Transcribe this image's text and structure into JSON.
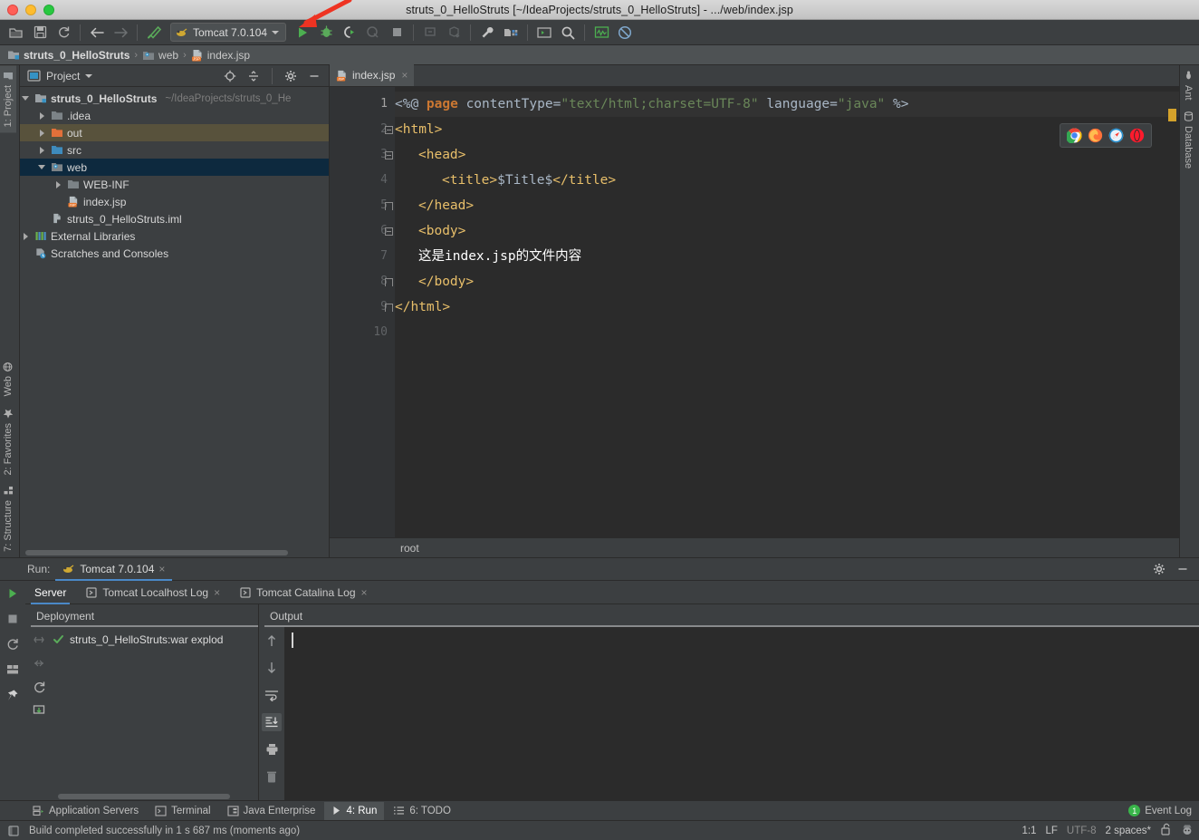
{
  "window": {
    "title": "struts_0_HelloStruts [~/IdeaProjects/struts_0_HelloStruts] - .../web/index.jsp"
  },
  "toolbar": {
    "run_config_label": "Tomcat 7.0.104",
    "icons": [
      "open-folder-icon",
      "save-all-icon",
      "sync-refresh-icon",
      "back-arrow-icon",
      "forward-arrow-icon",
      "build-hammer-icon",
      "run-icon",
      "debug-icon",
      "run-with-coverage-icon",
      "profile-icon",
      "stop-icon",
      "update-app-icon",
      "deploy-icon",
      "settings-wrench-icon",
      "project-structure-icon",
      "terminal-icon",
      "search-everywhere-icon",
      "monitor-icon",
      "no-access-icon"
    ]
  },
  "breadcrumb": {
    "items": [
      {
        "label": "struts_0_HelloStruts",
        "icon": "module-icon"
      },
      {
        "label": "web",
        "icon": "web-folder-icon"
      },
      {
        "label": "index.jsp",
        "icon": "jsp-file-icon"
      }
    ],
    "separator": "›"
  },
  "left_toolbar": {
    "top": [
      {
        "label": "1: Project",
        "active": true
      }
    ],
    "bottom": [
      {
        "label": "Web",
        "icon": "web-icon"
      },
      {
        "label": "2: Favorites",
        "icon": "star-icon",
        "underline": "2"
      },
      {
        "label": "7: Structure",
        "icon": "structure-icon",
        "underline": "7"
      }
    ]
  },
  "right_toolbar": {
    "items": [
      {
        "label": "Ant",
        "icon": "ant-icon"
      },
      {
        "label": "Database",
        "icon": "database-icon"
      }
    ]
  },
  "project_panel": {
    "title": "Project",
    "header_icons": [
      "locate-target-icon",
      "collapse-all-icon",
      "gear-icon",
      "hide-minimize-icon"
    ],
    "tree": [
      {
        "label": "struts_0_HelloStruts",
        "sub": "~/IdeaProjects/struts_0_He",
        "indent": 0,
        "arrow": "down",
        "icon": "module-icon",
        "bold": true,
        "state": "normal"
      },
      {
        "label": ".idea",
        "sub": "",
        "indent": 1,
        "arrow": "right",
        "icon": "folder-icon",
        "bold": false,
        "state": "normal"
      },
      {
        "label": "out",
        "sub": "",
        "indent": 1,
        "arrow": "right",
        "icon": "folder-orange-icon",
        "bold": false,
        "state": "highlight"
      },
      {
        "label": "src",
        "sub": "",
        "indent": 1,
        "arrow": "right",
        "icon": "folder-source-icon",
        "bold": false,
        "state": "normal"
      },
      {
        "label": "web",
        "sub": "",
        "indent": 1,
        "arrow": "down",
        "icon": "web-folder-icon",
        "bold": false,
        "state": "selected"
      },
      {
        "label": "WEB-INF",
        "sub": "",
        "indent": 2,
        "arrow": "right",
        "icon": "folder-icon",
        "bold": false,
        "state": "normal"
      },
      {
        "label": "index.jsp",
        "sub": "",
        "indent": 2,
        "arrow": "none",
        "icon": "jsp-file-icon",
        "bold": false,
        "state": "normal"
      },
      {
        "label": "struts_0_HelloStruts.iml",
        "sub": "",
        "indent": 1,
        "arrow": "none",
        "icon": "iml-file-icon",
        "bold": false,
        "state": "normal"
      },
      {
        "label": "External Libraries",
        "sub": "",
        "indent": 0,
        "arrow": "right",
        "icon": "libraries-icon",
        "bold": false,
        "state": "normal"
      },
      {
        "label": "Scratches and Consoles",
        "sub": "",
        "indent": 0,
        "arrow": "none",
        "icon": "scratches-icon",
        "bold": false,
        "state": "normal"
      }
    ]
  },
  "editor": {
    "tab": {
      "label": "index.jsp",
      "icon": "jsp-file-icon",
      "close": "×"
    },
    "breadcrumb_label": "root",
    "browsers": [
      {
        "name": "chrome-icon",
        "color": "#4285f4"
      },
      {
        "name": "firefox-icon",
        "color": "#ff7139"
      },
      {
        "name": "safari-icon",
        "color": "#1b88ca"
      },
      {
        "name": "opera-icon",
        "color": "#ff1b2d"
      }
    ],
    "line_numbers": [
      "1",
      "2",
      "3",
      "4",
      "5",
      "6",
      "7",
      "8",
      "9",
      "10"
    ],
    "code_lines": [
      {
        "n": 1,
        "indent": 0,
        "tokens": [
          {
            "t": "<%@ ",
            "c": "k-gray"
          },
          {
            "t": "page",
            "c": "k-orangeb"
          },
          {
            "t": " contentType=",
            "c": "k-gray"
          },
          {
            "t": "\"text/html;charset=UTF-8\"",
            "c": "k-green"
          },
          {
            "t": " language=",
            "c": "k-gray"
          },
          {
            "t": "\"java\"",
            "c": "k-green"
          },
          {
            "t": " %>",
            "c": "k-gray"
          }
        ],
        "highlight": true
      },
      {
        "n": 2,
        "indent": 0,
        "tokens": [
          {
            "t": "<html>",
            "c": "k-tag"
          }
        ],
        "highlight": false
      },
      {
        "n": 3,
        "indent": 1,
        "tokens": [
          {
            "t": "<head>",
            "c": "k-tag"
          }
        ],
        "highlight": false
      },
      {
        "n": 4,
        "indent": 2,
        "tokens": [
          {
            "t": "<title>",
            "c": "k-tag"
          },
          {
            "t": "$Title$",
            "c": "k-gray"
          },
          {
            "t": "</title>",
            "c": "k-tag"
          }
        ],
        "highlight": false
      },
      {
        "n": 5,
        "indent": 1,
        "tokens": [
          {
            "t": "</head>",
            "c": "k-tag"
          }
        ],
        "highlight": false
      },
      {
        "n": 6,
        "indent": 1,
        "tokens": [
          {
            "t": "<body>",
            "c": "k-tag"
          }
        ],
        "highlight": false
      },
      {
        "n": 7,
        "indent": 1,
        "tokens": [
          {
            "t": "这是index.jsp的文件内容",
            "c": "k-text"
          }
        ],
        "highlight": false
      },
      {
        "n": 8,
        "indent": 1,
        "tokens": [
          {
            "t": "</body>",
            "c": "k-tag"
          }
        ],
        "highlight": false
      },
      {
        "n": 9,
        "indent": 0,
        "tokens": [
          {
            "t": "</html>",
            "c": "k-tag"
          }
        ],
        "highlight": false
      },
      {
        "n": 10,
        "indent": 0,
        "tokens": [
          {
            "t": "",
            "c": "k-gray"
          }
        ],
        "highlight": false
      }
    ]
  },
  "run_panel": {
    "run_label": "Run:",
    "config_tab": {
      "label": "Tomcat 7.0.104",
      "icon": "tomcat-icon",
      "close": "×"
    },
    "header_icons": [
      "gear-icon",
      "hide-minimize-icon"
    ],
    "side_buttons": [
      "rerun-icon",
      "stop-icon",
      "restart-icon",
      "layout-icon",
      "pin-icon"
    ],
    "tabs": [
      {
        "label": "Server",
        "icon": "",
        "active": true,
        "closable": false
      },
      {
        "label": "Tomcat Localhost Log",
        "icon": "log-icon",
        "active": false,
        "closable": true
      },
      {
        "label": "Tomcat Catalina Log",
        "icon": "log-icon",
        "active": false,
        "closable": true
      }
    ],
    "deployment": {
      "title": "Deployment",
      "tools": [
        "expand-all-icon",
        "collapse-all-icon",
        "redeploy-icon",
        "undeploy-icon"
      ],
      "items": [
        {
          "label": "struts_0_HelloStruts:war explod",
          "status": "success",
          "icon": "check-icon"
        }
      ]
    },
    "output": {
      "title": "Output",
      "tools": [
        "scroll-up-icon",
        "scroll-down-icon",
        "soft-wrap-icon",
        "scroll-to-end-icon",
        "print-icon",
        "clear-all-icon"
      ],
      "selected_tool": "scroll-to-end-icon",
      "content": ""
    }
  },
  "bottom_toolwindows": {
    "items": [
      {
        "label": "Application Servers",
        "icon": "app-servers-icon",
        "active": false
      },
      {
        "label": "Terminal",
        "icon": "terminal-icon",
        "active": false
      },
      {
        "label": "Java Enterprise",
        "icon": "java-ee-icon",
        "active": false
      },
      {
        "label": "4: Run",
        "icon": "run-icon",
        "active": true,
        "underline": "4"
      },
      {
        "label": "6: TODO",
        "icon": "todo-icon",
        "active": false,
        "underline": "6"
      }
    ],
    "event_log": {
      "label": "Event Log",
      "badge": "1"
    }
  },
  "status_bar": {
    "message": "Build completed successfully in 1 s 687 ms (moments ago)",
    "caret_position": "1:1",
    "line_separator": "LF",
    "encoding": "UTF-8",
    "indent": "2 spaces*",
    "lock_icon": "unlock-icon",
    "inspector_icon": "hector-icon"
  },
  "colors": {
    "accent_blue": "#4a88c7",
    "selection_blue": "#0d293e",
    "highlight_tan": "#58523c",
    "success_green": "#39b54a",
    "editor_bg": "#2b2b2b",
    "panel_bg": "#3c3f41",
    "annotation_red": "#ee3322"
  }
}
